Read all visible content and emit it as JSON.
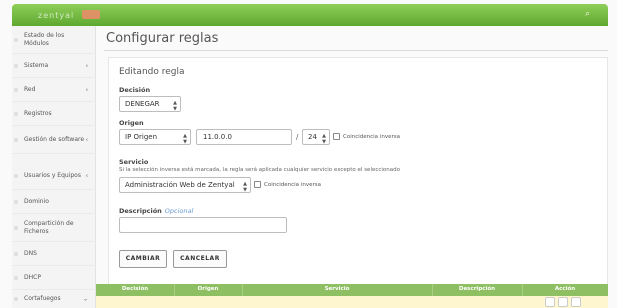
{
  "app": {
    "brand": "zentyal"
  },
  "sidebar": {
    "items": [
      {
        "label": "Estado de los Módulos",
        "chevron": ""
      },
      {
        "label": "Sistema",
        "chevron": "‹"
      },
      {
        "label": "Red",
        "chevron": "‹"
      },
      {
        "label": "Registros",
        "chevron": ""
      },
      {
        "label": "Gestión de software",
        "chevron": "‹"
      },
      {
        "label": "Usuarios y Equipos",
        "chevron": "‹"
      },
      {
        "label": "Dominio",
        "chevron": ""
      },
      {
        "label": "Compartición de Ficheros",
        "chevron": ""
      },
      {
        "label": "DNS",
        "chevron": ""
      },
      {
        "label": "DHCP",
        "chevron": ""
      },
      {
        "label": "Cortafuegos",
        "chevron": "⌄"
      }
    ]
  },
  "page": {
    "title": "Configurar reglas"
  },
  "form": {
    "title": "Editando regla",
    "decision": {
      "label": "Decisión",
      "value": "DENEGAR"
    },
    "origen": {
      "label": "Origen",
      "type_value": "IP Origen",
      "ip_value": "11.0.0.0",
      "separator": "/",
      "mask_value": "24",
      "inverse_label": "Coincidencia inversa"
    },
    "servicio": {
      "label": "Servicio",
      "hint": "Si la selección inversa está marcada, la regla será aplicada cualquier servicio excepto el seleccionado",
      "value": "Administración Web de Zentyal",
      "inverse_label": "Coincidencia inversa"
    },
    "descripcion": {
      "label": "Descripción",
      "optional": "Opcional",
      "value": ""
    },
    "buttons": {
      "change": "CAMBIAR",
      "cancel": "CANCELAR"
    }
  },
  "table": {
    "headers": [
      "Decisión",
      "Origen",
      "Servicio",
      "Descripción",
      "Acción"
    ]
  }
}
